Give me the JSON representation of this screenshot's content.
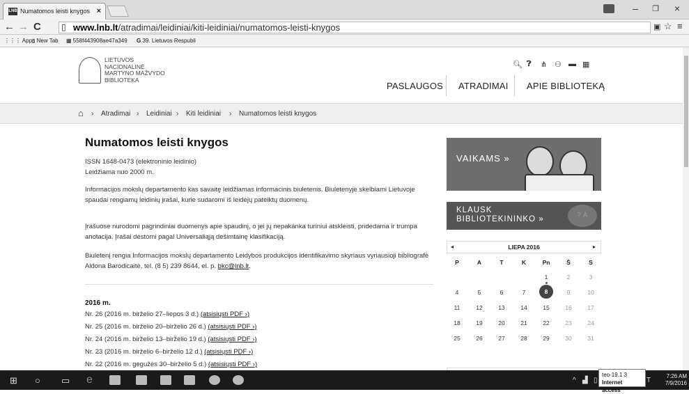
{
  "browser": {
    "tab_title": "Numatomos leisti knygos",
    "tab_favicon": "LNB",
    "tab_close": "×",
    "window_min": "–",
    "window_restore": "❐",
    "window_close": "×",
    "url_host": "www.lnb.lt",
    "url_path": "/atradimai/leidiniai/kiti-leidiniai/numatomos-leisti-knygos",
    "bookmarks": [
      "Apps",
      "New Tab",
      "558f443908ae47a349",
      "39. Lietuvos Respubli"
    ]
  },
  "site": {
    "logo_lines": [
      "LIETUVOS",
      "NACIONALINĖ",
      "MARTYNO MAŽVYDO",
      "BIBLIOTEKA"
    ],
    "nav": [
      "PASLAUGOS",
      "ATRADIMAI",
      "APIE BIBLIOTEKĄ"
    ],
    "top_icons": [
      "search-icon",
      "info-icon",
      "sitemap-icon",
      "accessibility-icon",
      "flag-lt-icon",
      "flag-en-icon"
    ]
  },
  "breadcrumb": [
    "Atradimai",
    "Leidiniai",
    "Kiti leidiniai",
    "Numatomos leisti knygos"
  ],
  "content": {
    "title": "Numatomos leisti knygos",
    "issn": "ISSN 1648-0473 (elektroninio leidinio)",
    "since": "Leidžiama nuo 2000 m.",
    "para1": "Informacijos mokslų departamento kas savaitę leidžiamas informacinis biuletenis. Biuletenyje skelbiami Lietuvoje spaudai rengiamų leidinių įrašai, kurie sudaromi iš leidėjų pateiktų duomenų.",
    "para2": "Įrašuose nurodomi pagrindiniai duomenys apie spaudinį, o jei jų nepakanka turiniui atskleisti, pridedama ir trumpa anotacija. Įrašai dėstomi pagal Universaliąją dešimtainę klasifikaciją.",
    "para3": "Biuletenį rengia Informacijos mokslų departamento Leidybos produkcijos identifikavimo skyriaus vyriausioji bibliografė Aldona Barodicaitė, tel. (8 5) 239 8644, el. p. ",
    "email": "bkc@lnb.lt",
    "year": "2016 m.",
    "issues": [
      {
        "text": "Nr. 26 (2016 m. birželio 27–liepos 3 d.) ",
        "link": "(atsisiųsti PDF ›)"
      },
      {
        "text": "Nr. 25 (2016 m. birželio 20–birželio 26 d.) ",
        "link": "(atsisiųsti PDF ›)"
      },
      {
        "text": "Nr. 24 (2016 m. birželio 13–birželio 19 d.) ",
        "link": "(atsisiųsti PDF ›)"
      },
      {
        "text": "Nr. 23 (2016 m. birželio 6–birželio 12 d.) ",
        "link": "(atsisiųsti PDF ›)"
      },
      {
        "text": "Nr. 22 (2016 m. gegužės 30–birželio 5 d.) ",
        "link": "(atsisiųsti PDF ›)"
      }
    ]
  },
  "sidebar": {
    "banner1": "VAIKAMS »",
    "banner2_line1": "KLAUSK",
    "banner2_line2": "BIBLIOTEKININKO »",
    "calendar": {
      "month": "LIEPA 2016",
      "prev": "◂",
      "next": "▸",
      "dow": [
        "P",
        "A",
        "T",
        "K",
        "Pn",
        "Š",
        "S"
      ],
      "weeks": [
        [
          "",
          "",
          "",
          "",
          "1",
          "2",
          "3"
        ],
        [
          "4",
          "5",
          "6",
          "7",
          "8",
          "9",
          "10"
        ],
        [
          "11",
          "12",
          "13",
          "14",
          "15",
          "16",
          "17"
        ],
        [
          "18",
          "19",
          "20",
          "21",
          "22",
          "23",
          "24"
        ],
        [
          "25",
          "26",
          "27",
          "28",
          "29",
          "30",
          "31"
        ]
      ],
      "today": "8"
    }
  },
  "taskbar": {
    "time": "7:26 AM",
    "date": "7/9/2016",
    "tooltip_line1": "teo-19.1 3",
    "tooltip_line2": "Internet access",
    "tray_extra": "T"
  }
}
